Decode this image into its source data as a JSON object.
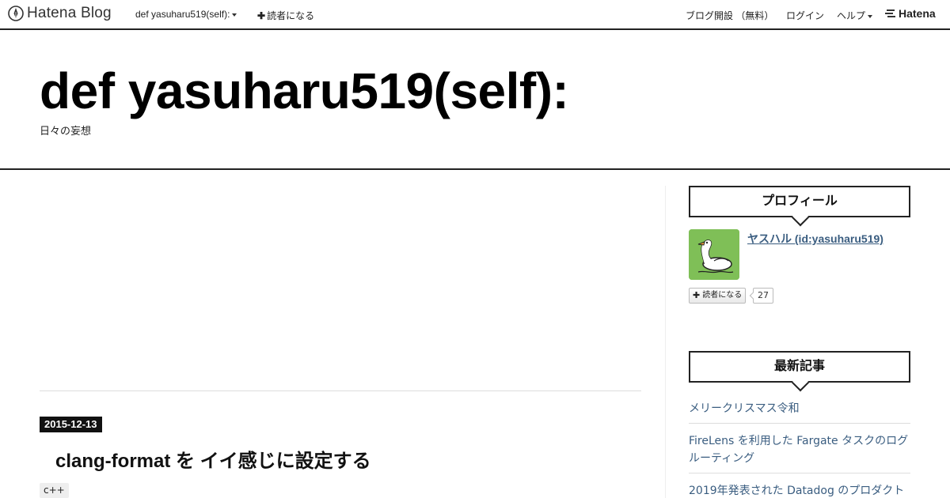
{
  "topbar": {
    "logo_text": "Hatena Blog",
    "blog_menu_label": "def yasuharu519(self):",
    "subscribe_label": "読者になる",
    "open_blog_label": "ブログ開設 （無料）",
    "login_label": "ログイン",
    "help_label": "ヘルプ",
    "hatena_label": "Hatena"
  },
  "header": {
    "title": "def yasuharu519(self):",
    "description": "日々の妄想"
  },
  "entry": {
    "date": "2015-12-13",
    "title": "clang-format を イイ感じに設定する",
    "category": "c++"
  },
  "sidebar": {
    "profile": {
      "title": "プロフィール",
      "name": "ヤスハル (id:yasuharu519)",
      "subscribe_label": "読者になる",
      "subscriber_count": "27"
    },
    "recent": {
      "title": "最新記事",
      "items": [
        "メリークリスマス令和",
        "FireLens を利用した Fargate タスクのログルーティング",
        "2019年発表された Datadog のプロダクト"
      ]
    }
  },
  "colors": {
    "link": "#3a5d80",
    "avatar_bg": "#7fbf57",
    "border": "#222222"
  }
}
